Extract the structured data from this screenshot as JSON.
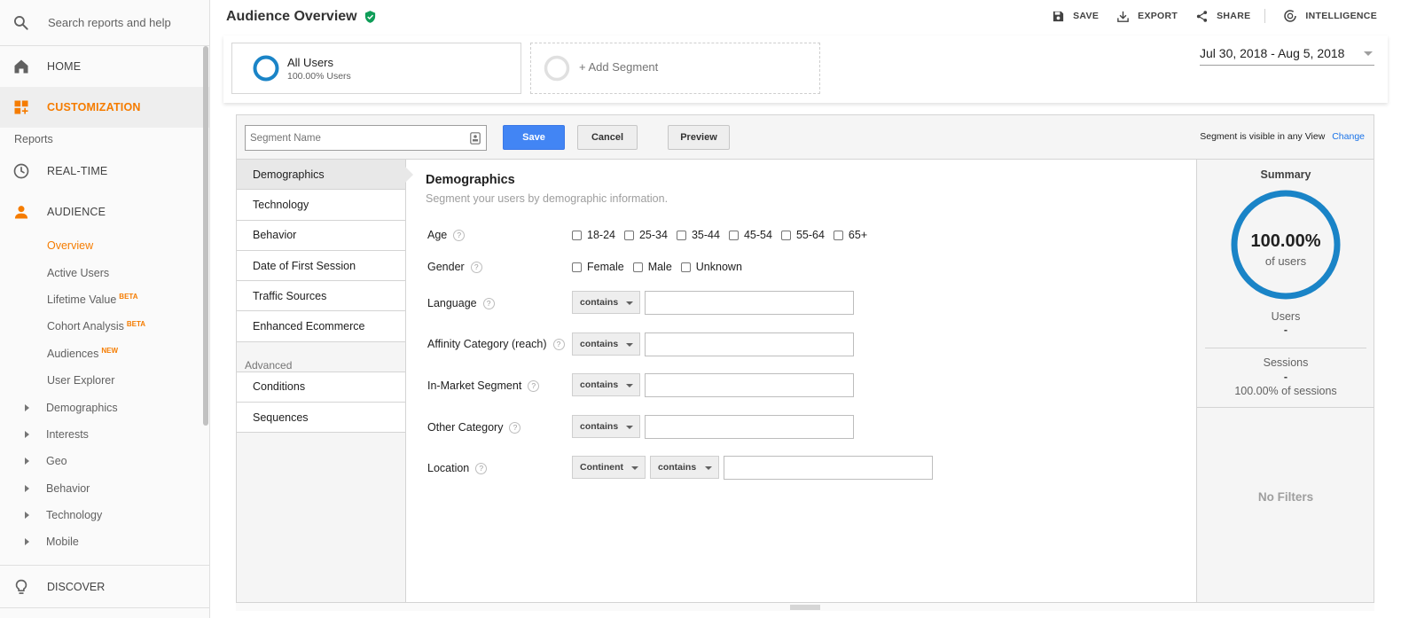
{
  "sidebar": {
    "search_placeholder": "Search reports and help",
    "home": "HOME",
    "customization": "CUSTOMIZATION",
    "reports_section": "Reports",
    "realtime": "REAL-TIME",
    "audience": "AUDIENCE",
    "audience_items": [
      {
        "label": "Overview"
      },
      {
        "label": "Active Users"
      },
      {
        "label": "Lifetime Value",
        "badge": "BETA"
      },
      {
        "label": "Cohort Analysis",
        "badge": "BETA"
      },
      {
        "label": "Audiences",
        "badge": "NEW"
      },
      {
        "label": "User Explorer"
      }
    ],
    "expandable_items": [
      "Demographics",
      "Interests",
      "Geo",
      "Behavior",
      "Technology",
      "Mobile"
    ],
    "discover": "DISCOVER"
  },
  "header": {
    "title": "Audience Overview",
    "actions": {
      "save": "SAVE",
      "export": "EXPORT",
      "share": "SHARE",
      "intelligence": "INTELLIGENCE"
    }
  },
  "segments": {
    "current": {
      "name": "All Users",
      "detail": "100.00% Users"
    },
    "add_label": "+ Add Segment",
    "date_range": "Jul 30, 2018 - Aug 5, 2018"
  },
  "builder": {
    "name_placeholder": "Segment Name",
    "save": "Save",
    "cancel": "Cancel",
    "preview": "Preview",
    "visibility_text": "Segment is visible in any View",
    "visibility_link": "Change",
    "tabs": [
      "Demographics",
      "Technology",
      "Behavior",
      "Date of First Session",
      "Traffic Sources",
      "Enhanced Ecommerce"
    ],
    "advanced_label": "Advanced",
    "advanced_tabs": [
      "Conditions",
      "Sequences"
    ],
    "form": {
      "title": "Demographics",
      "subtitle": "Segment your users by demographic information.",
      "age_label": "Age",
      "age_options": [
        "18-24",
        "25-34",
        "35-44",
        "45-54",
        "55-64",
        "65+"
      ],
      "gender_label": "Gender",
      "gender_options": [
        "Female",
        "Male",
        "Unknown"
      ],
      "language_label": "Language",
      "affinity_label": "Affinity Category (reach)",
      "inmarket_label": "In-Market Segment",
      "other_label": "Other Category",
      "location_label": "Location",
      "match_op": "contains",
      "location_scope": "Continent",
      "help_glyph": "?"
    },
    "summary": {
      "title": "Summary",
      "percent": "100.00%",
      "percent_caption": "of users",
      "percent_value": 100,
      "users_label": "Users",
      "users_value": "-",
      "sessions_label": "Sessions",
      "sessions_value": "-",
      "sessions_pct": "100.00% of sessions",
      "no_filters": "No Filters"
    }
  },
  "colors": {
    "accent_orange": "#f57c00",
    "primary_blue": "#4285f4",
    "ring_blue": "#1a84c7",
    "verified_green": "#0f9d58"
  }
}
